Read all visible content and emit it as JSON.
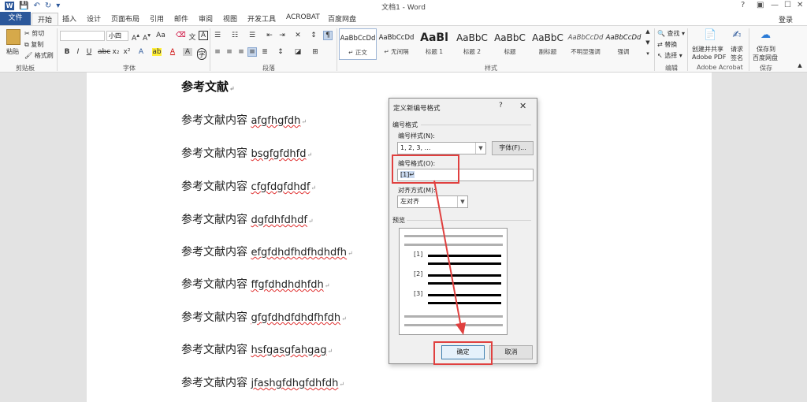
{
  "titlebar": {
    "app_logo": "W",
    "doc_title": "文档1 - Word",
    "controls": [
      "?",
      "▣",
      "—",
      "☐",
      "✕"
    ]
  },
  "tabs": {
    "file": "文件",
    "items": [
      "开始",
      "插入",
      "设计",
      "页面布局",
      "引用",
      "邮件",
      "审阅",
      "视图",
      "开发工具",
      "ACROBAT",
      "百度网盘"
    ],
    "login": "登录"
  },
  "ribbon": {
    "clipboard": {
      "paste": "粘贴",
      "cut": "剪切",
      "copy": "复制",
      "format_painter": "格式刷",
      "label": "剪贴板"
    },
    "font": {
      "font_name": "",
      "font_size": "小四",
      "label": "字体",
      "buttons": [
        "B",
        "I",
        "U",
        "abc",
        "x₂",
        "x²"
      ]
    },
    "paragraph": {
      "label": "段落"
    },
    "styles": {
      "label": "样式",
      "items": [
        {
          "sample": "AaBbCcDd",
          "name": "↵ 正文"
        },
        {
          "sample": "AaBbCcDd",
          "name": "↵ 无间隔"
        },
        {
          "sample": "AaBl",
          "name": "标题 1"
        },
        {
          "sample": "AaBbC",
          "name": "标题 2"
        },
        {
          "sample": "AaBbC",
          "name": "标题"
        },
        {
          "sample": "AaBbC",
          "name": "副标题"
        },
        {
          "sample": "AaBbCcDd",
          "name": "不明显强调"
        },
        {
          "sample": "AaBbCcDd",
          "name": "强调"
        }
      ]
    },
    "editing": {
      "find": "查找",
      "replace": "替换",
      "select": "选择",
      "label": "编辑"
    },
    "acrobat": {
      "create_share": "创建并共享",
      "create_share_2": "Adobe PDF",
      "request": "请求",
      "request_2": "签名",
      "label": "Adobe Acrobat"
    },
    "save": {
      "save_to": "保存到",
      "save_to_2": "百度网盘",
      "label": "保存"
    }
  },
  "document": {
    "heading": "参考文献",
    "para_mark": "↵",
    "ref_prefix": "参考文献内容 ",
    "refs": [
      "afgfhgfdh",
      "bsgfgfdhfd",
      "cfgfdgfdhdf",
      "dgfdhfdhdf",
      "efgfdhdfhdfhdhdfh",
      "ffgfdhdhdhfdh",
      "gfgfdhdfdhdfhfdh",
      "hsfgasgfahgag",
      "jfashgfdhgfdhfdh"
    ]
  },
  "dialog": {
    "title": "定义新编号格式",
    "help": "?",
    "close": "✕",
    "section_format": "编号格式",
    "style_label": "编号样式(N):",
    "style_value": "1, 2, 3, …",
    "font_button": "字体(F)...",
    "format_label": "编号格式(O):",
    "format_value": "[1]↵",
    "align_label": "对齐方式(M):",
    "align_value": "左对齐",
    "preview_label": "预览",
    "preview_numbers": [
      "[1]",
      "[2]",
      "[3]"
    ],
    "ok": "确定",
    "cancel": "取消"
  },
  "colors": {
    "accent": "#2b579a",
    "highlight": "#e0403f",
    "squiggle": "#e03030"
  }
}
